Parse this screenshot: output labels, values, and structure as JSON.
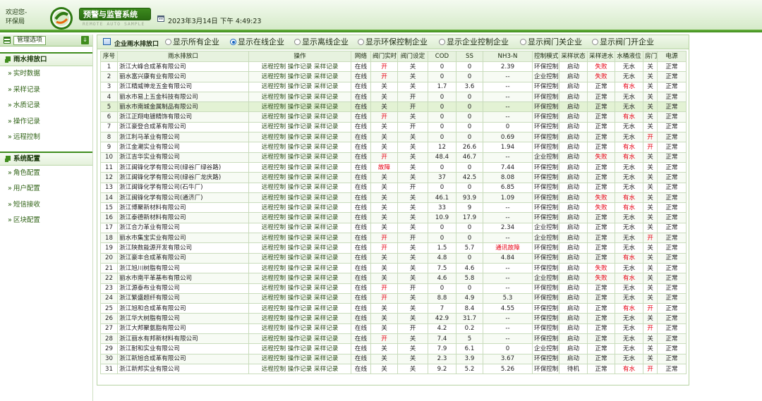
{
  "header": {
    "welcome_line1": "欢迎您-",
    "welcome_line2": "环保局",
    "system_title": "预警与监管系统",
    "system_subtitle": "REMOTE AUTO SAMPLE",
    "datetime": "2023年3月14日 下午 4:49:23"
  },
  "sidebar": {
    "menu_button": "管理选项",
    "download_icon": "download-arrow-icon",
    "sections": [
      {
        "title": "雨水排放口",
        "items": [
          "实时数据",
          "采样记录",
          "水质记录",
          "操作记录",
          "远程控制"
        ]
      },
      {
        "title": "系统配置",
        "items": [
          "角色配置",
          "用户配置",
          "短信接收",
          "区块配置"
        ]
      }
    ]
  },
  "main": {
    "tab_title": "企业雨水排放口",
    "filters": [
      {
        "label": "显示所有企业",
        "checked": false
      },
      {
        "label": "显示在线企业",
        "checked": true
      },
      {
        "label": "显示离线企业",
        "checked": false
      },
      {
        "label": "显示环保控制企业",
        "checked": false
      },
      {
        "label": "显示企业控制企业",
        "checked": false
      },
      {
        "label": "显示阀门关企业",
        "checked": false
      },
      {
        "label": "显示阀门开企业",
        "checked": false
      }
    ],
    "columns": [
      "序号",
      "雨水排放口",
      "操作",
      "网络",
      "阀门实时",
      "阀门设定",
      "COD",
      "SS",
      "NH3-N",
      "控制模式",
      "采样状态",
      "采样进水",
      "水桶液位",
      "房门",
      "电源"
    ],
    "ops": [
      "远程控制",
      "操作记录",
      "采样记录"
    ],
    "rows": [
      [
        "1",
        "浙江大峰合成革有限公司",
        "在线",
        "开",
        "关",
        "0",
        "0",
        "2.39",
        "环保控制",
        "启动",
        "失败",
        "无水",
        "关",
        "正常"
      ],
      [
        "2",
        "丽水富兴康有业有限公司",
        "在线",
        "开",
        "关",
        "0",
        "0",
        "--",
        "企业控制",
        "启动",
        "失败",
        "无水",
        "关",
        "正常"
      ],
      [
        "3",
        "浙江精威神龙五金有限公司",
        "在线",
        "关",
        "关",
        "1.7",
        "3.6",
        "--",
        "环保控制",
        "启动",
        "正常",
        "有水",
        "关",
        "正常"
      ],
      [
        "4",
        "丽水市易上五金科技有限公司",
        "在线",
        "关",
        "开",
        "0",
        "0",
        "--",
        "环保控制",
        "启动",
        "正常",
        "无水",
        "关",
        "正常"
      ],
      [
        "5",
        "丽水市南城金属制品有限公司",
        "在线",
        "关",
        "开",
        "0",
        "0",
        "--",
        "环保控制",
        "启动",
        "正常",
        "无水",
        "关",
        "正常"
      ],
      [
        "6",
        "浙江正翔电镀精饰有限公司",
        "在线",
        "开",
        "关",
        "0",
        "0",
        "--",
        "环保控制",
        "启动",
        "正常",
        "有水",
        "关",
        "正常"
      ],
      [
        "7",
        "浙江豪登合成革有限公司",
        "在线",
        "关",
        "开",
        "0",
        "0",
        "0",
        "环保控制",
        "启动",
        "正常",
        "无水",
        "关",
        "正常"
      ],
      [
        "8",
        "浙江利马革业有限公司",
        "在线",
        "关",
        "关",
        "0",
        "0",
        "0.69",
        "环保控制",
        "启动",
        "正常",
        "无水",
        "开",
        "正常"
      ],
      [
        "9",
        "浙江金潮实业有限公司",
        "在线",
        "关",
        "关",
        "12",
        "26.6",
        "1.94",
        "环保控制",
        "启动",
        "正常",
        "有水",
        "开",
        "正常"
      ],
      [
        "10",
        "浙江吉华实业有限公司",
        "在线",
        "开",
        "关",
        "48.4",
        "46.7",
        "--",
        "企业控制",
        "启动",
        "失败",
        "有水",
        "关",
        "正常"
      ],
      [
        "11",
        "浙江闽锋化学有限公司(绿谷厂绿谷路)",
        "在线",
        "故障",
        "关",
        "0",
        "0",
        "7.44",
        "环保控制",
        "启动",
        "正常",
        "无水",
        "关",
        "正常"
      ],
      [
        "12",
        "浙江闽锋化学有限公司(绿谷厂龙庆路)",
        "在线",
        "关",
        "关",
        "37",
        "42.5",
        "8.08",
        "环保控制",
        "启动",
        "正常",
        "无水",
        "关",
        "正常"
      ],
      [
        "13",
        "浙江闽锋化学有限公司(石牛厂)",
        "在线",
        "关",
        "开",
        "0",
        "0",
        "6.85",
        "环保控制",
        "启动",
        "正常",
        "无水",
        "关",
        "正常"
      ],
      [
        "14",
        "浙江闽锋化学有限公司(通济厂)",
        "在线",
        "关",
        "关",
        "46.1",
        "93.9",
        "1.09",
        "环保控制",
        "启动",
        "失败",
        "有水",
        "关",
        "正常"
      ],
      [
        "15",
        "浙江博聚新材料有限公司",
        "在线",
        "关",
        "关",
        "33",
        "9",
        "--",
        "环保控制",
        "启动",
        "失败",
        "有水",
        "关",
        "正常"
      ],
      [
        "16",
        "浙江泰德新材料有限公司",
        "在线",
        "关",
        "关",
        "10.9",
        "17.9",
        "--",
        "环保控制",
        "启动",
        "正常",
        "无水",
        "关",
        "正常"
      ],
      [
        "17",
        "浙江合力革业有限公司",
        "在线",
        "关",
        "关",
        "0",
        "0",
        "2.34",
        "企业控制",
        "启动",
        "正常",
        "无水",
        "关",
        "正常"
      ],
      [
        "18",
        "丽水市集宝实业有限公司",
        "在线",
        "开",
        "开",
        "0",
        "0",
        "--",
        "企业控制",
        "启动",
        "正常",
        "无水",
        "开",
        "正常"
      ],
      [
        "19",
        "浙江陕数能源开发有限公司",
        "在线",
        "开",
        "关",
        "1.5",
        "5.7",
        "通讯故障",
        "环保控制",
        "启动",
        "正常",
        "无水",
        "关",
        "正常"
      ],
      [
        "20",
        "浙江豪丰合成革有限公司",
        "在线",
        "关",
        "关",
        "4.8",
        "0",
        "4.84",
        "环保控制",
        "启动",
        "正常",
        "有水",
        "关",
        "正常"
      ],
      [
        "21",
        "浙江旭川树脂有限公司",
        "在线",
        "关",
        "关",
        "7.5",
        "4.6",
        "--",
        "环保控制",
        "启动",
        "失败",
        "无水",
        "关",
        "正常"
      ],
      [
        "22",
        "丽水市南平革基布有限公司",
        "在线",
        "关",
        "关",
        "4.6",
        "5.8",
        "--",
        "企业控制",
        "启动",
        "失败",
        "有水",
        "关",
        "正常"
      ],
      [
        "23",
        "浙江源泰布业有限公司",
        "在线",
        "开",
        "开",
        "0",
        "0",
        "--",
        "环保控制",
        "启动",
        "正常",
        "无水",
        "关",
        "正常"
      ],
      [
        "24",
        "浙江繁盛超纤有限公司",
        "在线",
        "开",
        "关",
        "8.8",
        "4.9",
        "5.3",
        "环保控制",
        "启动",
        "正常",
        "无水",
        "关",
        "正常"
      ],
      [
        "25",
        "浙江旭和合成革有限公司",
        "在线",
        "关",
        "关",
        "7",
        "8.4",
        "4.55",
        "环保控制",
        "启动",
        "正常",
        "有水",
        "开",
        "正常"
      ],
      [
        "26",
        "浙江华大树脂有限公司",
        "在线",
        "关",
        "关",
        "42.9",
        "31.7",
        "--",
        "环保控制",
        "启动",
        "正常",
        "无水",
        "关",
        "正常"
      ],
      [
        "27",
        "浙江大邦聚氨脂有限公司",
        "在线",
        "关",
        "开",
        "4.2",
        "0.2",
        "--",
        "环保控制",
        "启动",
        "正常",
        "无水",
        "开",
        "正常"
      ],
      [
        "28",
        "浙江丽水有邦新材料有限公司",
        "在线",
        "开",
        "关",
        "7.4",
        "5",
        "--",
        "环保控制",
        "启动",
        "正常",
        "无水",
        "关",
        "正常"
      ],
      [
        "29",
        "浙江耐和实业有限公司",
        "在线",
        "关",
        "关",
        "7.9",
        "6.1",
        "0",
        "企业控制",
        "启动",
        "正常",
        "无水",
        "关",
        "正常"
      ],
      [
        "30",
        "浙江新旭合成革有限公司",
        "在线",
        "关",
        "关",
        "2.3",
        "3.9",
        "3.67",
        "环保控制",
        "启动",
        "正常",
        "无水",
        "关",
        "正常"
      ],
      [
        "31",
        "浙江新邦实业有限公司",
        "在线",
        "关",
        "关",
        "9.2",
        "5.2",
        "5.26",
        "环保控制",
        "待机",
        "正常",
        "有水",
        "开",
        "正常"
      ]
    ],
    "highlight_row": 5,
    "colors": {
      "alert": "#e60012",
      "accent": "#3f8c1d"
    }
  }
}
